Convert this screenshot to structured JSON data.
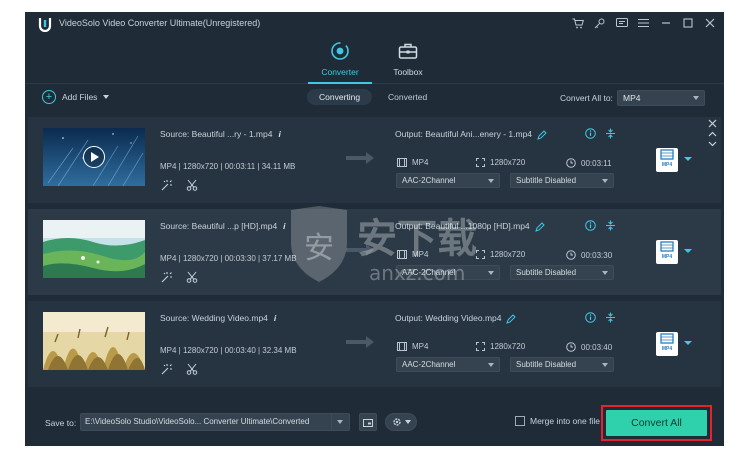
{
  "app": {
    "title": "VideoSolo Video Converter Ultimate(Unregistered)",
    "accent_color": "#3fc8e4",
    "convert_color": "#2ed1ab",
    "highlight_color": "#e4242c",
    "titlebar_icons": [
      "cart-icon",
      "key-icon",
      "feedback-icon",
      "menu-icon",
      "minimize-icon",
      "maximize-icon",
      "close-icon"
    ]
  },
  "nav": {
    "converter_label": "Converter",
    "toolbox_label": "Toolbox"
  },
  "toolbar": {
    "add_files_label": "Add Files",
    "tab_converting": "Converting",
    "tab_converted": "Converted",
    "convert_all_to_label": "Convert All to:",
    "convert_all_to_value": "MP4"
  },
  "files": [
    {
      "source": "Source: Beautiful ...ry - 1.mp4",
      "meta": "MP4 | 1280x720 | 00:03:11 | 34.11 MB",
      "output": "Output: Beautiful Ani...enery - 1.mp4",
      "out_format": "MP4",
      "out_resolution": "1280x720",
      "out_duration": "00:03:11",
      "audio": "AAC-2Channel",
      "subtitle": "Subtitle Disabled",
      "badge": "MP4"
    },
    {
      "source": "Source: Beautiful ...p [HD].mp4",
      "meta": "MP4 | 1280x720 | 00:03:30 | 37.17 MB",
      "output": "Output: Beautiful ...1080p [HD].mp4",
      "out_format": "MP4",
      "out_resolution": "1280x720",
      "out_duration": "00:03:30",
      "audio": "AAC-2Channel",
      "subtitle": "Subtitle Disabled",
      "badge": "MP4"
    },
    {
      "source": "Source: Wedding Video.mp4",
      "meta": "MP4 | 1280x720 | 00:03:40 | 32.34 MB",
      "output": "Output: Wedding Video.mp4",
      "out_format": "MP4",
      "out_resolution": "1280x720",
      "out_duration": "00:03:40",
      "audio": "AAC-2Channel",
      "subtitle": "Subtitle Disabled",
      "badge": "MP4"
    }
  ],
  "watermark": {
    "cn_text": "安下载",
    "latin_text": "anxz.com"
  },
  "bottom": {
    "save_to_label": "Save to:",
    "save_path": "E:\\VideoSolo Studio\\VideoSolo... Converter Ultimate\\Converted",
    "merge_label": "Merge into one file",
    "merge_checked": false,
    "convert_all_label": "Convert All"
  }
}
